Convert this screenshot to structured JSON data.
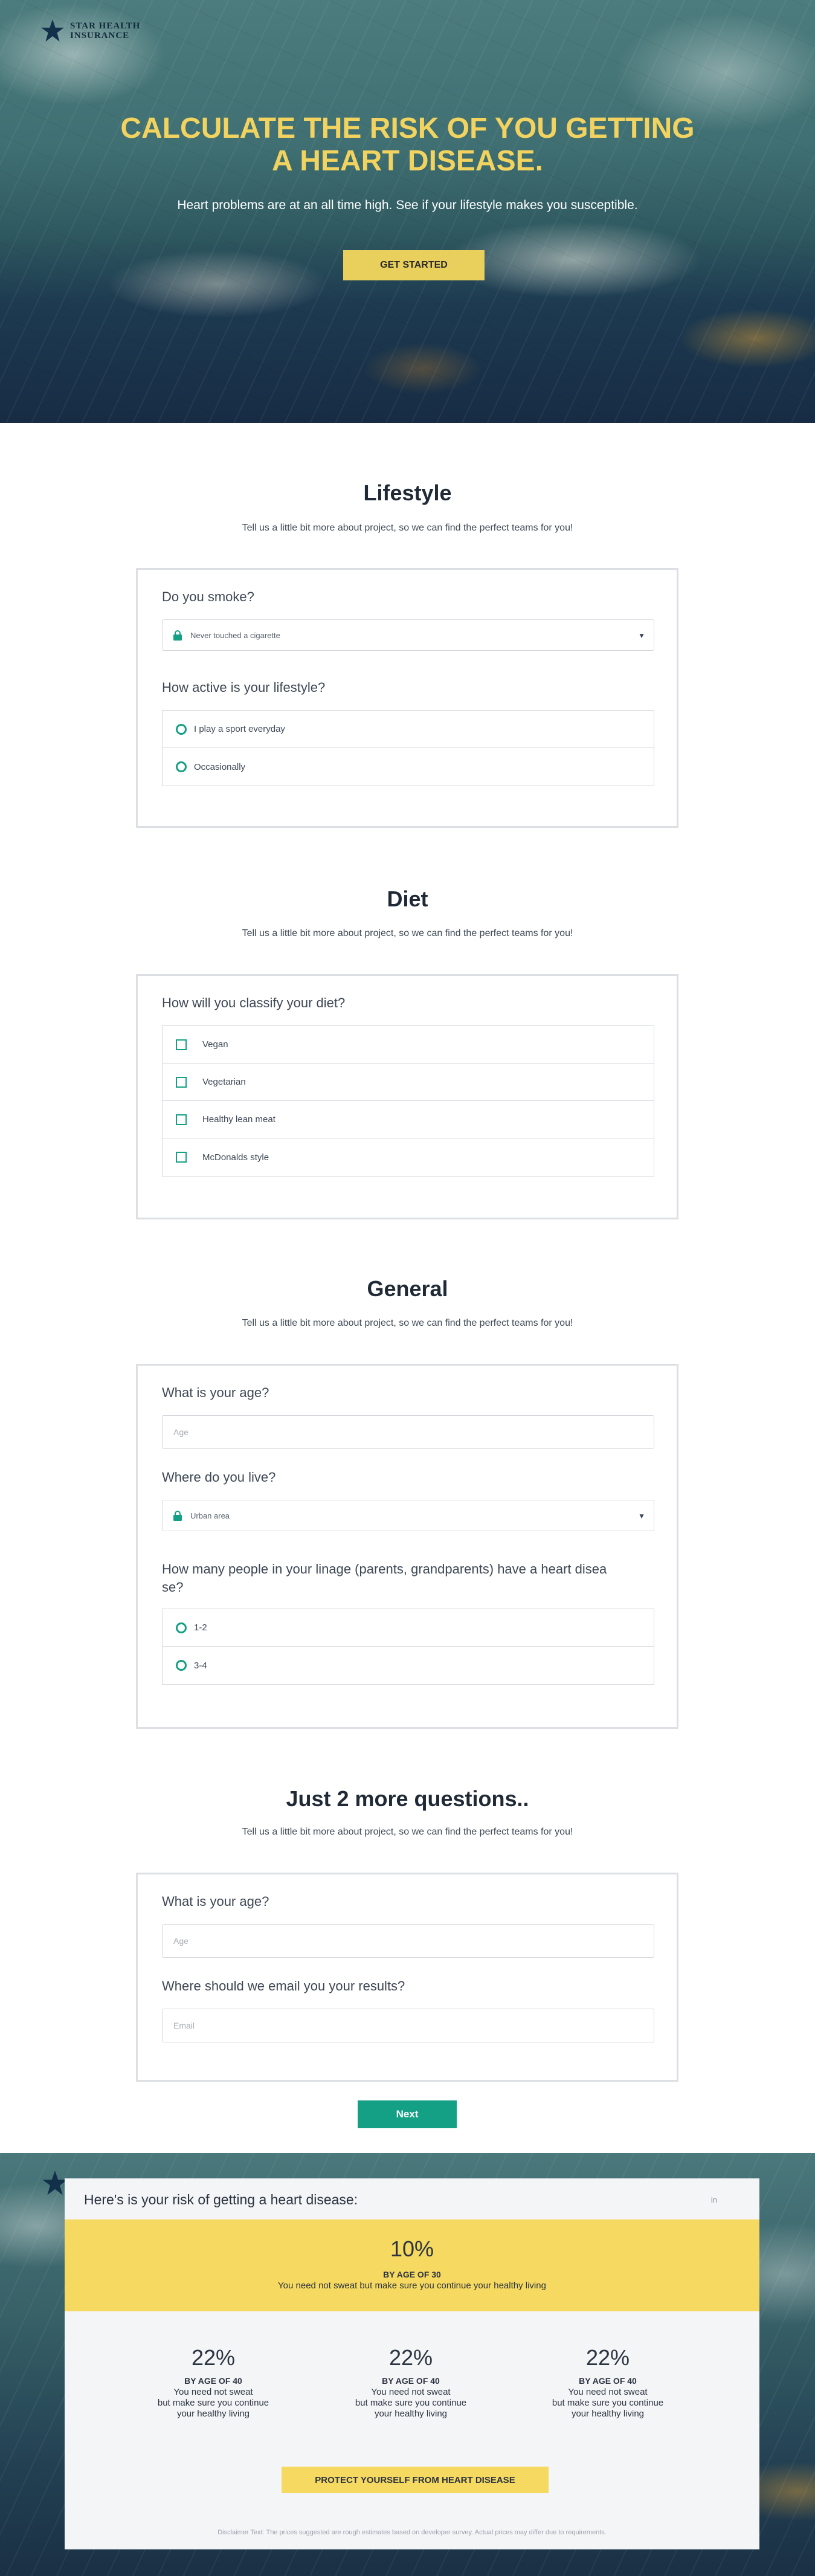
{
  "brand": {
    "name_line1": "STAR HEALTH",
    "name_line2": "INSURANCE"
  },
  "hero": {
    "title_line1": "CALCULATE THE RISK OF YOU GETTING",
    "title_line2": "A HEART DISEASE.",
    "subtitle": "Heart problems are at an all time high. See if your lifestyle makes you susceptible.",
    "cta": "GET STARTED"
  },
  "lifestyle": {
    "title": "Lifestyle",
    "subtitle": "Tell us a little bit more about project, so we can find the perfect teams for you!",
    "smoke_question": "Do you smoke?",
    "smoke_value": "Never touched a cigarette",
    "active_question": "How active is your lifestyle?",
    "active_options": [
      "I play a sport everyday",
      "Occasionally"
    ]
  },
  "diet": {
    "title": "Diet",
    "subtitle": "Tell us a little bit more about project, so we can find the perfect teams for you!",
    "question": "How will you classify your diet?",
    "options": [
      "Vegan",
      "Vegetarian",
      "Healthy lean meat",
      "McDonalds style"
    ]
  },
  "general": {
    "title": "General",
    "subtitle": "Tell us a little bit more about project, so we can find the perfect teams for you!",
    "age_question": "What is your age?",
    "age_placeholder": "Age",
    "live_question": "Where do you live?",
    "live_value": "Urban area",
    "linage_question_line1": "How many people in your linage (parents, grandparents) have a heart disea",
    "linage_question_line2": "se?",
    "linage_options": [
      "1-2",
      "3-4"
    ]
  },
  "final": {
    "title": "Just 2 more questions..",
    "subtitle": "Tell us a little bit more about project, so we can find the perfect teams for you!",
    "age_question": "What is your age?",
    "age_placeholder": "Age",
    "email_question": "Where should we email you your results?",
    "email_placeholder": "Email",
    "next": "Next"
  },
  "results": {
    "title": "Here's is your risk of getting a heart disease:",
    "badge": "in",
    "highlight": {
      "percent": "10%",
      "age": "BY AGE OF 30",
      "message": "You need not sweat but make sure you continue your healthy living"
    },
    "stats": [
      {
        "percent": "22%",
        "age": "BY AGE OF 40",
        "msg1": "You need not sweat",
        "msg2": "but make sure you continue",
        "msg3": "your healthy living"
      },
      {
        "percent": "22%",
        "age": "BY AGE OF 40",
        "msg1": "You need not sweat",
        "msg2": "but make sure you continue",
        "msg3": "your healthy living"
      },
      {
        "percent": "22%",
        "age": "BY AGE OF 40",
        "msg1": "You need not sweat",
        "msg2": "but make sure you continue",
        "msg3": "your healthy living"
      }
    ],
    "cta": "PROTECT YOURSELF FROM HEART DISEASE",
    "disclaimer": "Disclaimer Text: The prices suggested are rough estimates based on developer survey. Actual prices may differ due to requirements."
  },
  "colors": {
    "accent_yellow": "#f6d961",
    "accent_green": "#14a085",
    "hero_title": "#f2d35f"
  },
  "icons": {
    "logo": "star-icon",
    "select": "lock-icon",
    "dropdown": "caret-down-icon"
  }
}
